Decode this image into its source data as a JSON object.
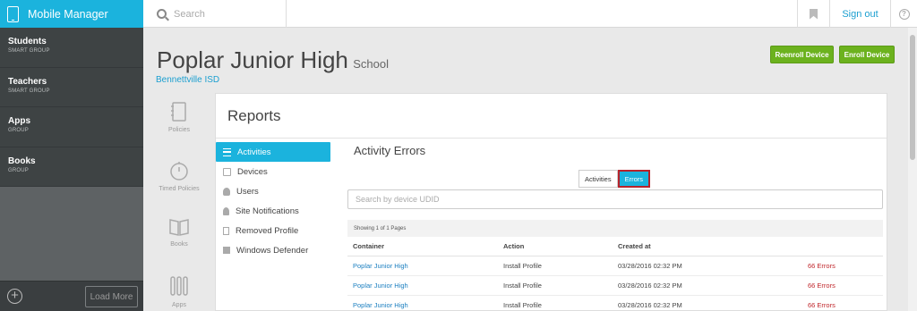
{
  "app": {
    "title": "Mobile Manager"
  },
  "search": {
    "placeholder": "Search"
  },
  "topbar": {
    "signout": "Sign out"
  },
  "sidebar": {
    "items": [
      {
        "name": "Students",
        "sub": "SMART GROUP"
      },
      {
        "name": "Teachers",
        "sub": "SMART GROUP"
      },
      {
        "name": "Apps",
        "sub": "GROUP"
      },
      {
        "name": "Books",
        "sub": "GROUP"
      }
    ],
    "load_more": "Load More"
  },
  "header": {
    "title": "Poplar Junior High",
    "type": "School",
    "district": "Bennettville ISD",
    "reenroll": "Reenroll Device",
    "enroll": "Enroll Device"
  },
  "rail": {
    "policies": "Policies",
    "timed_policies": "Timed Policies",
    "books": "Books",
    "apps": "Apps"
  },
  "reports": {
    "title": "Reports",
    "nav": [
      {
        "label": "Activities",
        "icon": "list-icon",
        "active": true
      },
      {
        "label": "Devices",
        "icon": "device-icon"
      },
      {
        "label": "Users",
        "icon": "user-icon"
      },
      {
        "label": "Site Notifications",
        "icon": "bell-icon"
      },
      {
        "label": "Removed Profile",
        "icon": "document-icon"
      },
      {
        "label": "Windows Defender",
        "icon": "windows-icon"
      }
    ]
  },
  "errors": {
    "title": "Activity Errors",
    "toggle_activities": "Activities",
    "toggle_errors": "Errors",
    "udid_placeholder": "Search by device UDID",
    "showing": "Showing 1 of 1 Pages",
    "columns": [
      "Container",
      "Action",
      "Created at",
      ""
    ],
    "rows": [
      {
        "container": "Poplar Junior High",
        "action": "Install Profile",
        "created": "03/28/2016 02:32 PM",
        "errors": "66 Errors"
      },
      {
        "container": "Poplar Junior High",
        "action": "Install Profile",
        "created": "03/28/2016 02:32 PM",
        "errors": "66 Errors"
      },
      {
        "container": "Poplar Junior High",
        "action": "Install Profile",
        "created": "03/28/2016 02:32 PM",
        "errors": "66 Errors"
      }
    ]
  }
}
